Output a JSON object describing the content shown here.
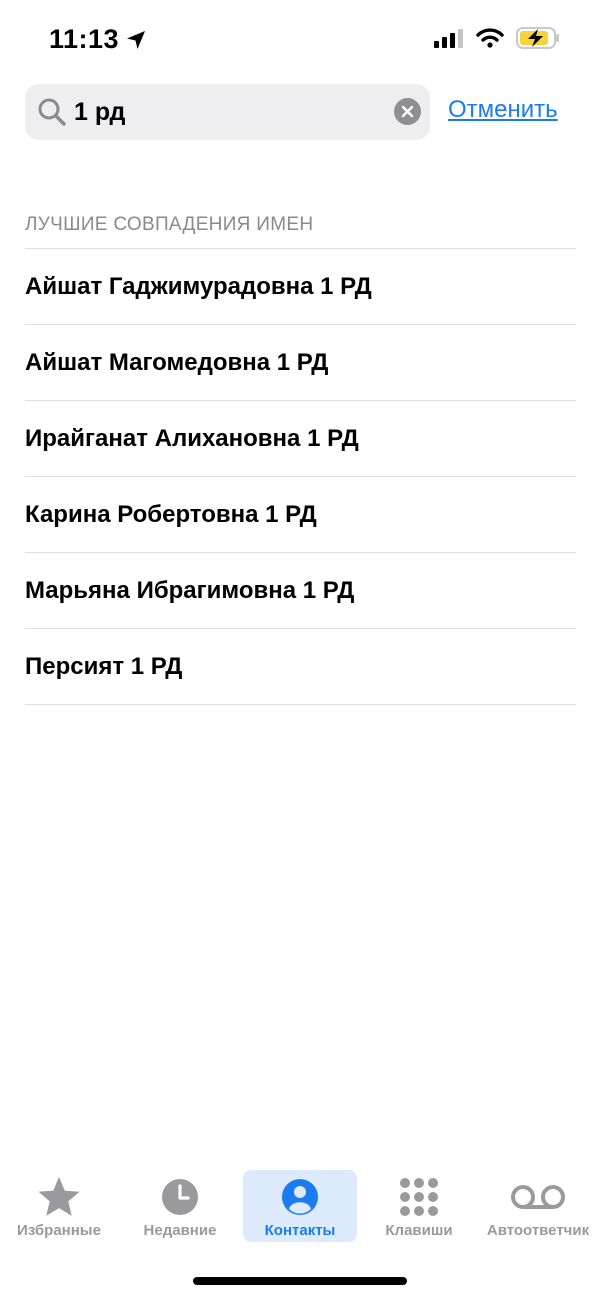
{
  "status_bar": {
    "time": "11:13",
    "battery_color": "#f5d33a",
    "icons": [
      "location-arrow-icon",
      "cellular-signal-icon",
      "wifi-icon",
      "battery-charging-icon"
    ]
  },
  "search": {
    "value": "1 рд",
    "placeholder": "Поиск",
    "cancel_label": "Отменить",
    "accent_color": "#1a7cf0"
  },
  "results": {
    "section_title": "ЛУЧШИЕ СОВПАДЕНИЯ ИМЕН",
    "items": [
      {
        "name": "Айшат Гаджимурадовна 1 РД"
      },
      {
        "name": "Айшат Магомедовна 1 РД"
      },
      {
        "name": "Ирайганат Алихановна 1 РД"
      },
      {
        "name": "Карина Робертовна 1 РД"
      },
      {
        "name": "Марьяна Ибрагимовна 1 РД"
      },
      {
        "name": "Персият 1 РД"
      }
    ]
  },
  "tab_bar": {
    "active": "Контакты",
    "tabs": [
      {
        "label": "Избранные",
        "icon": "star-icon"
      },
      {
        "label": "Недавние",
        "icon": "clock-icon"
      },
      {
        "label": "Контакты",
        "icon": "person-circle-icon"
      },
      {
        "label": "Клавиши",
        "icon": "keypad-icon"
      },
      {
        "label": "Автоответчик",
        "icon": "voicemail-icon"
      }
    ]
  }
}
